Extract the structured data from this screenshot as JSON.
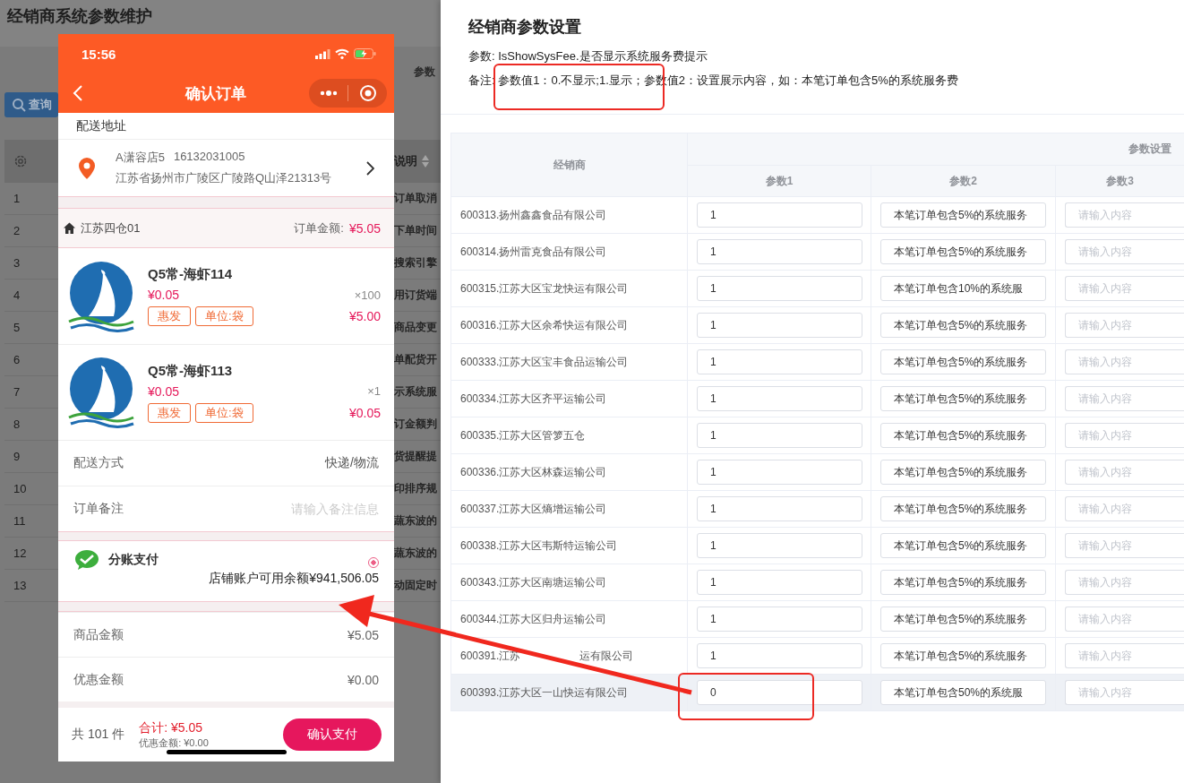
{
  "background_page": {
    "title": "经销商系统参数维护",
    "section_label": "参数",
    "search_button": "查询",
    "table": {
      "column": "说明",
      "rows": [
        {
          "index": "1",
          "description": "订单取消"
        },
        {
          "index": "2",
          "description": "下单时间"
        },
        {
          "index": "3",
          "description": "搜索引擎"
        },
        {
          "index": "4",
          "description": "用订货端"
        },
        {
          "index": "5",
          "description": "商品变更"
        },
        {
          "index": "6",
          "description": "单配货开"
        },
        {
          "index": "7",
          "description": "示系统服"
        },
        {
          "index": "8",
          "description": "订金额判"
        },
        {
          "index": "9",
          "description": "货提醒提"
        },
        {
          "index": "10",
          "description": "印排序规"
        },
        {
          "index": "11",
          "description": "蔬东波的"
        },
        {
          "index": "12",
          "description": "蔬东波的"
        },
        {
          "index": "13",
          "description": "动固定时"
        }
      ]
    }
  },
  "phone": {
    "status_bar": {
      "time": "15:56"
    },
    "nav": {
      "title": "确认订单"
    },
    "address": {
      "heading": "配送地址",
      "name": "A潇容店5",
      "phone": "16132031005",
      "line": "江苏省扬州市广陵区广陵路Q山泽21313号"
    },
    "store": {
      "name": "江苏四仓01",
      "total_label": "订单金额:",
      "total_value": "¥5.05"
    },
    "items": [
      {
        "name": "Q5常-海虾114",
        "price": "¥0.05",
        "tags": [
          "惠发",
          "单位:袋"
        ],
        "quantity": "×100",
        "subtotal": "¥5.00"
      },
      {
        "name": "Q5常-海虾113",
        "price": "¥0.05",
        "tags": [
          "惠发",
          "单位:袋"
        ],
        "quantity": "×1",
        "subtotal": "¥0.05"
      }
    ],
    "fields": [
      {
        "label": "配送方式",
        "value": "快递/物流"
      },
      {
        "label": "订单备注",
        "placeholder": "请输入备注信息"
      }
    ],
    "payment": {
      "name": "分账支付",
      "selected": true,
      "balance": "店铺账户可用余额¥941,506.05"
    },
    "summary": [
      {
        "label": "商品金额",
        "value": "¥5.05"
      },
      {
        "label": "优惠金额",
        "value": "¥0.00"
      }
    ],
    "footer": {
      "count": "共 101 件",
      "total": "合计: ¥5.05",
      "discount": "优惠金额: ¥0.00",
      "button": "确认支付"
    }
  },
  "drawer": {
    "title": "经销商参数设置",
    "param_line": "参数: IsShowSysFee.是否显示系统服务费提示",
    "note_line": "备注: 参数值1：0.不显示;1.显示；参数值2：设置展示内容，如：本笔订单包含5%的系统服务费",
    "table": {
      "dealer_column": "经销商",
      "group_column": "参数设置",
      "param_columns": [
        "参数1",
        "参数2",
        "参数3"
      ],
      "rows": [
        {
          "dealer": "600313.扬州鑫鑫食品有限公司",
          "param1": "1",
          "param2": "本笔订单包含5%的系统服务",
          "param3_placeholder": "请输入内容",
          "selected": false
        },
        {
          "dealer": "600314.扬州雷克食品有限公司",
          "param1": "1",
          "param2": "本笔订单包含5%的系统服务",
          "param3_placeholder": "请输入内容",
          "selected": false
        },
        {
          "dealer": "600315.江苏大区宝龙快运有限公司",
          "param1": "1",
          "param2": "本笔订单包含10%的系统服",
          "param3_placeholder": "请输入内容",
          "selected": false
        },
        {
          "dealer": "600316.江苏大区余希快运有限公司",
          "param1": "1",
          "param2": "本笔订单包含5%的系统服务",
          "param3_placeholder": "请输入内容",
          "selected": false
        },
        {
          "dealer": "600333.江苏大区宝丰食品运输公司",
          "param1": "1",
          "param2": "本笔订单包含5%的系统服务",
          "param3_placeholder": "请输入内容",
          "selected": false
        },
        {
          "dealer": "600334.江苏大区齐平运输公司",
          "param1": "1",
          "param2": "本笔订单包含5%的系统服务",
          "param3_placeholder": "请输入内容",
          "selected": false
        },
        {
          "dealer": "600335.江苏大区管箩五仓",
          "param1": "1",
          "param2": "本笔订单包含5%的系统服务",
          "param3_placeholder": "请输入内容",
          "selected": false
        },
        {
          "dealer": "600336.江苏大区林森运输公司",
          "param1": "1",
          "param2": "本笔订单包含5%的系统服务",
          "param3_placeholder": "请输入内容",
          "selected": false
        },
        {
          "dealer": "600337.江苏大区熵增运输公司",
          "param1": "1",
          "param2": "本笔订单包含5%的系统服务",
          "param3_placeholder": "请输入内容",
          "selected": false
        },
        {
          "dealer": "600338.江苏大区韦斯特运输公司",
          "param1": "1",
          "param2": "本笔订单包含5%的系统服务",
          "param3_placeholder": "请输入内容",
          "selected": false
        },
        {
          "dealer": "600343.江苏大区南塘运输公司",
          "param1": "1",
          "param2": "本笔订单包含5%的系统服务",
          "param3_placeholder": "请输入内容",
          "selected": false
        },
        {
          "dealer": "600344.江苏大区归舟运输公司",
          "param1": "1",
          "param2": "本笔订单包含5%的系统服务",
          "param3_placeholder": "请输入内容",
          "selected": false
        },
        {
          "dealer": "600391.江苏",
          "dealer_tail": "运有限公司",
          "param1": "1",
          "param2": "本笔订单包含5%的系统服务",
          "param3_placeholder": "请输入内容",
          "selected": false
        },
        {
          "dealer": "600393.江苏大区一山快运有限公司",
          "param1": "0",
          "param2": "本笔订单包含50%的系统服",
          "param3_placeholder": "请输入内容",
          "selected": true
        }
      ]
    }
  }
}
